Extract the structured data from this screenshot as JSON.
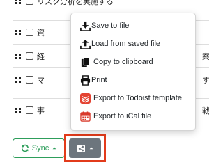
{
  "tasks": [
    {
      "text": "リスク分析を実施する",
      "tail": ""
    },
    {
      "text": "資",
      "tail": ""
    },
    {
      "text": "経",
      "tail": "案く"
    },
    {
      "text": "マ",
      "tail": "す"
    },
    {
      "text": "事",
      "tail": "戦"
    }
  ],
  "footer": {
    "sync_label": "Sync",
    "sync_color": "#2e9e5b",
    "share_button_color": "#6c757d",
    "highlight_color": "#e23b1b"
  },
  "export_menu": {
    "items": [
      {
        "label": "Save to file",
        "icon": "download-icon"
      },
      {
        "label": "Load from saved file",
        "icon": "upload-icon"
      },
      {
        "label": "Copy to clipboard",
        "icon": "clipboard-icon"
      },
      {
        "label": "Print",
        "icon": "printer-icon"
      },
      {
        "label": "Export to Todoist template",
        "icon": "todoist-icon"
      },
      {
        "label": "Export to iCal file",
        "icon": "calendar-icon"
      }
    ]
  }
}
